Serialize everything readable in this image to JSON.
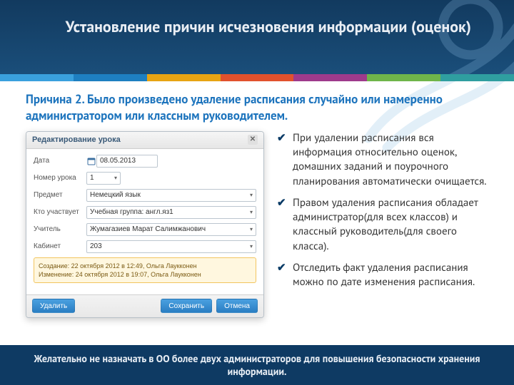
{
  "title": "Установление причин исчезновения информации (оценок)",
  "cause": "Причина 2. Было произведено удаление расписания случайно или намеренно администратором или классным руководителем.",
  "colorbar": [
    "#3aa0dd",
    "#1e7fc1",
    "#e7a413",
    "#e1512d",
    "#9e3a8c",
    "#6fb54a",
    "#2f9ea0"
  ],
  "dialog": {
    "title": "Редактирование урока",
    "fields": {
      "date": {
        "label": "Дата",
        "value": "08.05.2013"
      },
      "num": {
        "label": "Номер урока",
        "value": "1"
      },
      "subject": {
        "label": "Предмет",
        "value": "Немецкий язык"
      },
      "who": {
        "label": "Кто участвует",
        "value": "Учебная группа: англ.яз1"
      },
      "teacher": {
        "label": "Учитель",
        "value": "Жумагазиев Марат Салимжанович"
      },
      "room": {
        "label": "Кабинет",
        "value": "203"
      }
    },
    "meta": {
      "created": "Создание: 22 октября 2012 в 12:49, Ольга Лаукконен",
      "modified": "Изменение: 24 октября 2012 в 19:07, Ольга Лаукконен"
    },
    "buttons": {
      "delete": "Удалить",
      "save": "Сохранить",
      "cancel": "Отмена"
    }
  },
  "bullets": [
    "При удалении расписания вся информация относительно оценок, домашних заданий и поурочного планирования автоматически очищается.",
    "Правом удаления расписания обладает администратор(для всех классов) и классный руководитель(для своего класса).",
    "Отследить факт удаления расписания можно по дате изменения расписания."
  ],
  "footer": "Желательно не назначать в ОО более двух администраторов для повышения безопасности хранения информации."
}
